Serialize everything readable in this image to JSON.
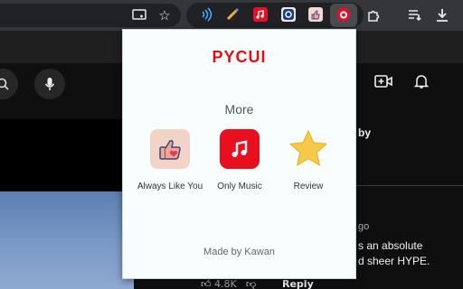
{
  "browser": {
    "extensions": [
      {
        "name": "cast-icon"
      },
      {
        "name": "star-icon"
      }
    ]
  },
  "page": {
    "comment_fragments": [
      "by",
      "go",
      "s an absolute",
      "d sheer HYPE."
    ],
    "like_count": "4.8K",
    "reply_label": "Reply"
  },
  "popup": {
    "title": "PYCUI",
    "section_label": "More",
    "apps": [
      {
        "label": "Always Like You",
        "icon": "thumbs-up-heart-icon"
      },
      {
        "label": "Only Music",
        "icon": "music-note-icon"
      },
      {
        "label": "Review",
        "icon": "star-icon"
      }
    ],
    "footer": "Made by Kawan",
    "accent_color": "#e0101a"
  }
}
